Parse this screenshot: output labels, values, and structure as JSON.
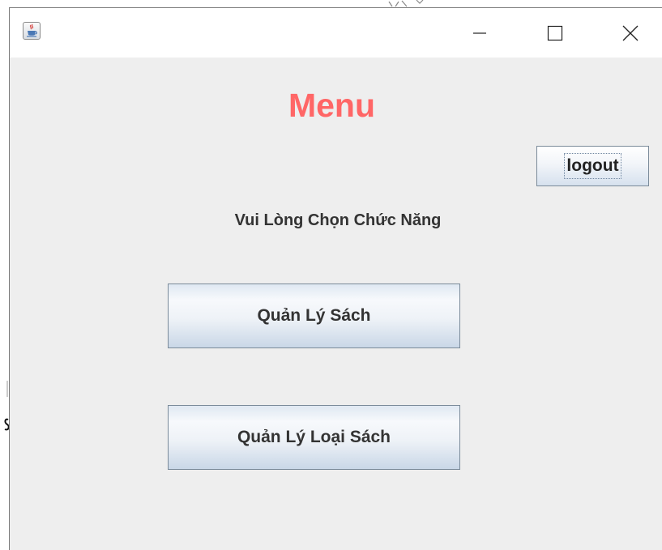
{
  "window": {
    "title": "",
    "app_icon": "java-cup-icon",
    "controls": {
      "minimize_icon": "minimize-icon",
      "maximize_icon": "maximize-icon",
      "close_icon": "close-icon"
    }
  },
  "menu": {
    "title": "Menu",
    "title_color": "#ff6666",
    "logout_label": "logout",
    "prompt": "Vui Lòng Chọn Chức Năng",
    "buttons": [
      {
        "label": "Quản Lý Sách"
      },
      {
        "label": "Quản Lý Loại Sách"
      }
    ]
  }
}
